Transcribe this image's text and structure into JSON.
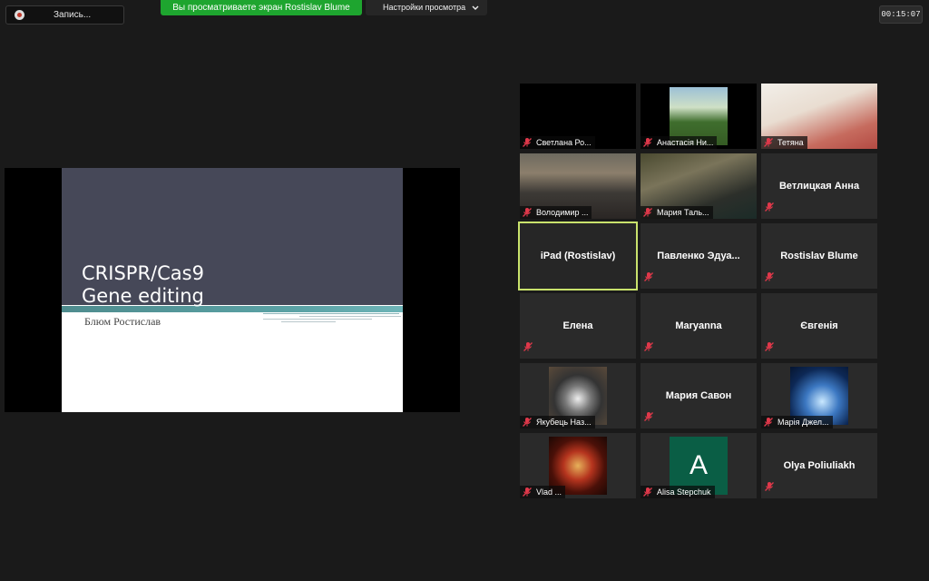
{
  "topbar": {
    "record_label": "Запись...",
    "share_banner": "Вы просматриваете экран Rostislav Blume",
    "view_options": "Настройки просмотра",
    "timer": "00:15:07"
  },
  "slide": {
    "title_line1": "CRISPR/Cas9",
    "title_line2": "Gene editing",
    "subtitle": "Блюм Ростислав"
  },
  "participants": [
    {
      "name": "Светлана Ро...",
      "muted": true
    },
    {
      "name": "Анастасія Ни...",
      "muted": true
    },
    {
      "name": "Тетяна",
      "muted": true
    },
    {
      "name": "Володимир ...",
      "muted": true
    },
    {
      "name": "Мария Таль...",
      "muted": true
    },
    {
      "name": "Ветлицкая Анна",
      "muted": true
    },
    {
      "name": "iPad (Rostislav)",
      "muted": false,
      "active": true
    },
    {
      "name": "Павленко  Эдуа...",
      "muted": true
    },
    {
      "name": "Rostislav Blume",
      "muted": true
    },
    {
      "name": "Елена",
      "muted": true
    },
    {
      "name": "Maryanna",
      "muted": true
    },
    {
      "name": "Євгенія",
      "muted": true
    },
    {
      "name": "Якубець Наз...",
      "muted": true
    },
    {
      "name": "Мария Савон",
      "muted": true
    },
    {
      "name": "Марія Джел...",
      "muted": true
    },
    {
      "name": "Vlad ...",
      "muted": true
    },
    {
      "name": "Alisa Stepchuk",
      "muted": true,
      "avatar_letter": "A"
    },
    {
      "name": "Olya Poliuliakh",
      "muted": true
    }
  ],
  "icons": {
    "record": "record-icon",
    "chevron": "chevron-down-icon",
    "mute": "muted-mic-icon"
  },
  "colors": {
    "banner": "#1ea52f",
    "active_border": "#c9e26c",
    "mute_red": "#e0384a"
  }
}
